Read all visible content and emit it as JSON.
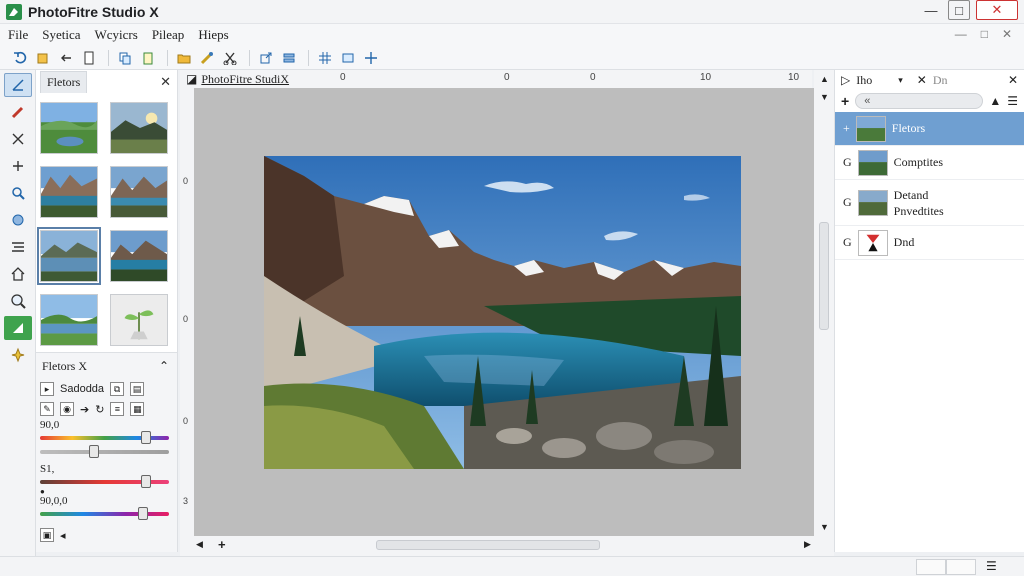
{
  "window": {
    "title": "PhotoFitre Studio X",
    "controls": [
      "—",
      "□",
      "✕"
    ]
  },
  "menu": {
    "items": [
      "File",
      "Syetica",
      "Wcyicrs",
      "Pileap",
      "Hieps"
    ],
    "right": [
      "—",
      "□",
      "✕"
    ]
  },
  "toolbar": {
    "icons": [
      "undo-icon",
      "open-icon",
      "back-icon",
      "page-icon",
      "copy-icon",
      "paste-icon",
      "folder-icon",
      "brush-icon",
      "cut-icon",
      "export-icon",
      "layers-icon",
      "grid-icon",
      "transform-icon",
      "move-icon"
    ]
  },
  "tools": [
    "select-tool-icon",
    "pencil-icon",
    "cross-icon",
    "plus-icon",
    "zoom-icon",
    "stamp-icon",
    "align-icon",
    "home-icon",
    "magnify-icon",
    "fill-icon",
    "pin-icon"
  ],
  "filters_panel": {
    "tab": "Fletors",
    "close": "✕"
  },
  "filters_x": {
    "title": "Fletors X",
    "collapse": "⌃",
    "row1_label": "Sadodda",
    "slider1": {
      "label": "90,0",
      "value": 0.82
    },
    "slider2": {
      "value": 0.4
    },
    "slider3": {
      "label": "S1,",
      "value": 0.82
    },
    "slider4": {
      "label": "90,0,0",
      "value": 0.8
    }
  },
  "canvas": {
    "tab_title": "PhotoFitre StudiX",
    "ruler_top": [
      "0",
      "0",
      "0",
      "10",
      "10"
    ],
    "ruler_left": [
      "0",
      "0",
      "0",
      "3"
    ]
  },
  "layers_panel": {
    "header": "Iho",
    "header_close": "✕",
    "header_pin": "Dn",
    "search_placeholder": "«",
    "layers": [
      {
        "label": "Fletors",
        "prefix": "+",
        "selected": true
      },
      {
        "label": "Comptites",
        "prefix": "G",
        "selected": false
      },
      {
        "label_line1": "Detand",
        "label_line2": "Pnvedtites",
        "prefix": "G",
        "selected": false
      },
      {
        "label": "Dnd",
        "prefix": "G",
        "selected": false
      }
    ]
  },
  "colors": {
    "accent": "#6f9fd1",
    "canvas_bg": "#bdbdbd",
    "selection": "#cfe1f3"
  }
}
